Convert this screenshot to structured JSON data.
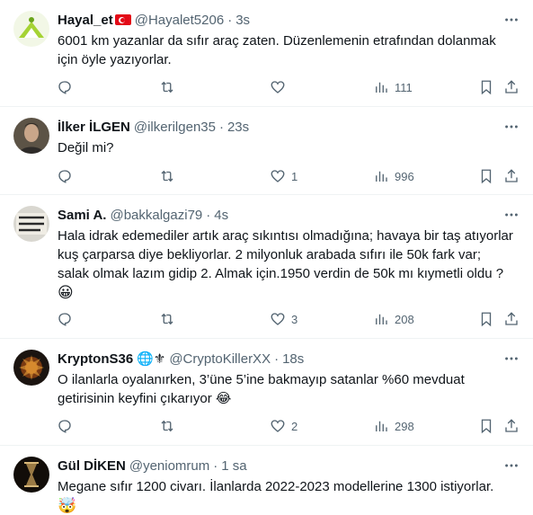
{
  "tweets": [
    {
      "name": "Hayal_et",
      "flag": "turkey-flag",
      "handle": "@Hayalet5206",
      "time": "3s",
      "lines": [
        "6001 km yazanlar da sıfır araç zaten. Düzenlemenin etrafından dolanmak",
        "için öyle yazıyorlar."
      ],
      "replies": "",
      "retweets": "",
      "likes": "",
      "views": "111"
    },
    {
      "name": "İlker İLGEN",
      "handle": "@ilkerilgen35",
      "time": "23s",
      "lines": [
        "Değil mi?"
      ],
      "replies": "",
      "retweets": "",
      "likes": "1",
      "views": "996"
    },
    {
      "name": "Sami A.",
      "handle": "@bakkalgazi79",
      "time": "4s",
      "lines": [
        "Hala idrak edemediler artık araç sıkıntısı olmadığına; havaya bir taş atıyorlar",
        "kuş çarparsa diye bekliyorlar. 2 milyonluk arabada sıfırı ile 50k fark var;",
        "salak olmak lazım gidip 2. Almak için.1950 verdin de 50k mı kıymetli oldu ?"
      ],
      "emoji": "😀",
      "replies": "",
      "retweets": "",
      "likes": "3",
      "views": "208"
    },
    {
      "name": "KryptonS36",
      "badges": "🌐⚜",
      "handle": "@CryptoKillerXX",
      "time": "18s",
      "lines": [
        "O ilanlarla oyalanırken, 3’üne 5’ine bakmayıp satanlar %60 mevduat",
        "getirisinin keyfini çıkarıyor 😂"
      ],
      "replies": "",
      "retweets": "",
      "likes": "2",
      "views": "298"
    },
    {
      "name": "Gül DİKEN",
      "handle": "@yeniomrum",
      "time": "1 sa",
      "lines": [
        "Megane sıfır 1200 civarı. İlanlarda 2022-2023 modellerine 1300 istiyorlar."
      ],
      "emoji": "🤯"
    }
  ],
  "colors": {
    "text": "#0f1419",
    "secondary": "#536471",
    "divider": "#eff3f4"
  },
  "icons": [
    "reply-icon",
    "retweet-icon",
    "like-icon",
    "views-icon",
    "bookmark-icon",
    "share-icon",
    "more-icon"
  ]
}
